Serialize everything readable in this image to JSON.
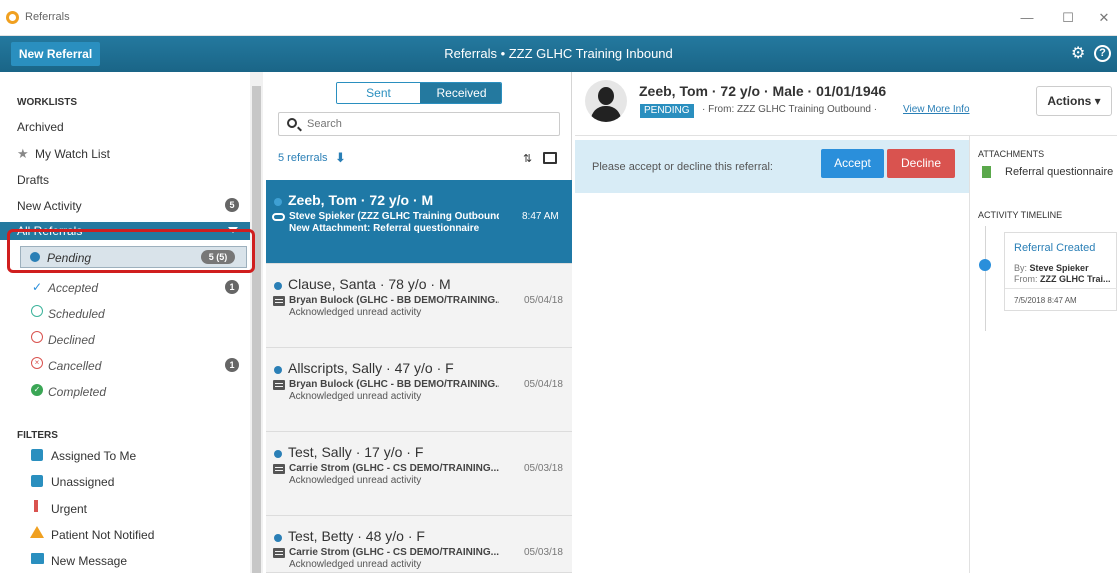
{
  "window": {
    "title": "Referrals",
    "minimize": "—",
    "maximize": "☐",
    "close": "✕"
  },
  "appbar": {
    "new_referral_label": "New Referral",
    "title": "Referrals • ZZZ GLHC Training Inbound"
  },
  "sidebar": {
    "worklists_header": "WORKLISTS",
    "archived": "Archived",
    "watch_list": "My Watch List",
    "drafts": "Drafts",
    "new_activity": "New Activity",
    "new_activity_count": "5",
    "all_referrals": "All Referrals",
    "pending": "Pending",
    "pending_count": "5 (5)",
    "accepted": "Accepted",
    "accepted_count": "1",
    "scheduled": "Scheduled",
    "declined": "Declined",
    "cancelled": "Cancelled",
    "cancelled_count": "1",
    "completed": "Completed",
    "filters_header": "FILTERS",
    "assigned_to_me": "Assigned To Me",
    "unassigned": "Unassigned",
    "urgent": "Urgent",
    "patient_not_notified": "Patient Not Notified",
    "new_message": "New Message"
  },
  "list": {
    "sent_tab": "Sent",
    "received_tab": "Received",
    "search_placeholder": "Search",
    "count": "5 referrals",
    "cards": [
      {
        "name": "Zeeb, Tom · 72 y/o · M",
        "from": "Steve Spieker (ZZZ GLHC Training Outbound)",
        "date": "8:47 AM",
        "activity": "New Attachment: Referral questionnaire"
      },
      {
        "name": "Clause, Santa · 78 y/o · M",
        "from": "Bryan Bulock (GLHC - BB DEMO/TRAINING...",
        "date": "05/04/18",
        "activity": "Acknowledged unread activity"
      },
      {
        "name": "Allscripts, Sally · 47 y/o · F",
        "from": "Bryan Bulock (GLHC - BB DEMO/TRAINING...",
        "date": "05/04/18",
        "activity": "Acknowledged unread activity"
      },
      {
        "name": "Test, Sally · 17 y/o · F",
        "from": "Carrie Strom (GLHC - CS DEMO/TRAINING...",
        "date": "05/03/18",
        "activity": "Acknowledged unread activity"
      },
      {
        "name": "Test, Betty · 48 y/o · F",
        "from": "Carrie Strom (GLHC - CS DEMO/TRAINING...",
        "date": "05/03/18",
        "activity": "Acknowledged unread activity"
      }
    ]
  },
  "detail": {
    "patient_name": "Zeeb, Tom · 72 y/o · Male · 01/01/1946",
    "status": "PENDING",
    "from": "· From: ZZZ GLHC Training Outbound ·",
    "view_more": "View More Info",
    "actions_label": "Actions ▾",
    "prompt": "Please accept or decline this referral:",
    "accept": "Accept",
    "decline": "Decline",
    "attachments_header": "ATTACHMENTS",
    "attachment_name": "Referral questionnaire",
    "timeline_header": "ACTIVITY TIMELINE",
    "timeline_title": "Referral Created",
    "timeline_by_label": "By:",
    "timeline_by": "Steve Spieker",
    "timeline_from_label": "From:",
    "timeline_from": "ZZZ GLHC Trai...",
    "timeline_time": "7/5/2018 8:47 AM"
  },
  "colors": {
    "accent": "#24799f",
    "accept": "#2a8fdb",
    "decline": "#d9534f",
    "highlight": "#d01e1e"
  }
}
